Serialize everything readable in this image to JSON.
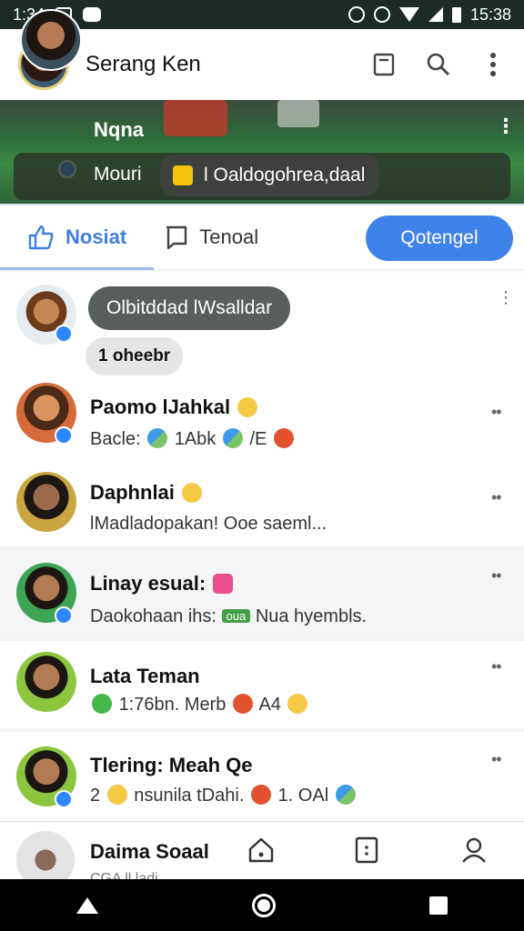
{
  "status_bar": {
    "time": "1:34",
    "clock": "15:38"
  },
  "header": {
    "title": "Serang Ken"
  },
  "banner": {
    "name": "Nqna",
    "sub_label": "Mouri",
    "chip_text": "l Oaldogohrea,daal"
  },
  "tabs": [
    {
      "label": "Nosiat",
      "active": true
    },
    {
      "label": "Tenoal",
      "active": false
    }
  ],
  "cta": {
    "label": "Qotengel"
  },
  "group": {
    "pill_text": "Olbitddad lWsalldar",
    "count_text": "1 oheebr"
  },
  "items": [
    {
      "name": "Paomo lJahkal",
      "sub_prefix": "Bacle:",
      "sub_mid": "1Abk",
      "sub_end": "/E"
    },
    {
      "name": "Daphnlai",
      "sub": "lMadladopakan! Ooe saeml..."
    },
    {
      "name": "Linay esual:",
      "sub_prefix": "Daokohaan ihs:",
      "tag": "oua",
      "sub_end": "Nua hyembls."
    },
    {
      "name": "Lata Teman",
      "sub_prefix": "1:76bn. Merb",
      "sub_end": "A4"
    },
    {
      "name": "Tlering: Meah Qe",
      "sub_prefix": "2",
      "sub_mid": "nsunila tDahi.",
      "sub_end": "1. OAl"
    }
  ],
  "bottom_nav": {
    "label": "Daima Soaal",
    "sub": "CGA ll ladi"
  },
  "colors": {
    "accent": "#3f83ea",
    "status_bar": "#1c2b26",
    "verified": "#2d88ff"
  },
  "icons": [
    "bookmark-icon",
    "search-icon",
    "more-vertical-icon",
    "like-icon",
    "comment-icon",
    "home-icon",
    "document-icon",
    "profile-icon"
  ]
}
